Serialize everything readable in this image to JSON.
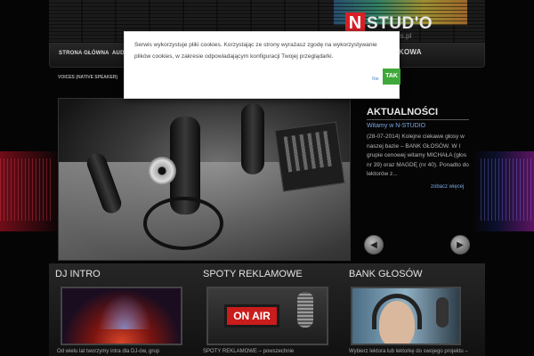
{
  "header": {
    "logo_letter": "N",
    "logo_word": "STUD'O",
    "logo_sub": "ls.pl"
  },
  "nav": {
    "item1": "STRONA GŁÓWNA",
    "item2": "AUDI",
    "item_right": "KOWA"
  },
  "breadcrumb": "VOICES (NATIVE SPEAKER)",
  "news": {
    "title": "AKTUALNOŚCI",
    "subtitle": "Witamy w N-STUDIO",
    "body": "(28-07-2014) Kolejne ciekawe głosy w naszej bazie – BANK GŁOSÓW. W I grupie cenowej witamy MICHAŁA (głos nr 39) oraz MAGDĘ (nr 40). Ponadto do lektorów z...",
    "more": "zobacz więcej",
    "prev_icon": "arrow-left-icon",
    "next_icon": "arrow-right-icon"
  },
  "columns": [
    {
      "title": "DJ INTRO",
      "text": "Od wielu lat tworzymy intra dla DJ-ów, grup"
    },
    {
      "title": "SPOTY REKLAMOWE",
      "onair": "ON AIR",
      "text": "SPOTY REKLAMOWE – powszechnie"
    },
    {
      "title": "BANK GŁOSÓW",
      "text": "Wybierz lektora lub lektorkę do swojego projektu –"
    }
  ],
  "cookie": {
    "text": "Serwis wykorzystuje pliki cookies. Korzystając ze strony wyrażasz zgodę na wykorzystywanie plików cookies, w zakresie odpowiadającym konfiguracji Twojej przeglądarki.",
    "no_label": "Nie",
    "yes_label": "TAK"
  },
  "colors": {
    "accent_red": "#d82028",
    "link_blue": "#7ca8e0",
    "button_green": "#3fa83a"
  }
}
